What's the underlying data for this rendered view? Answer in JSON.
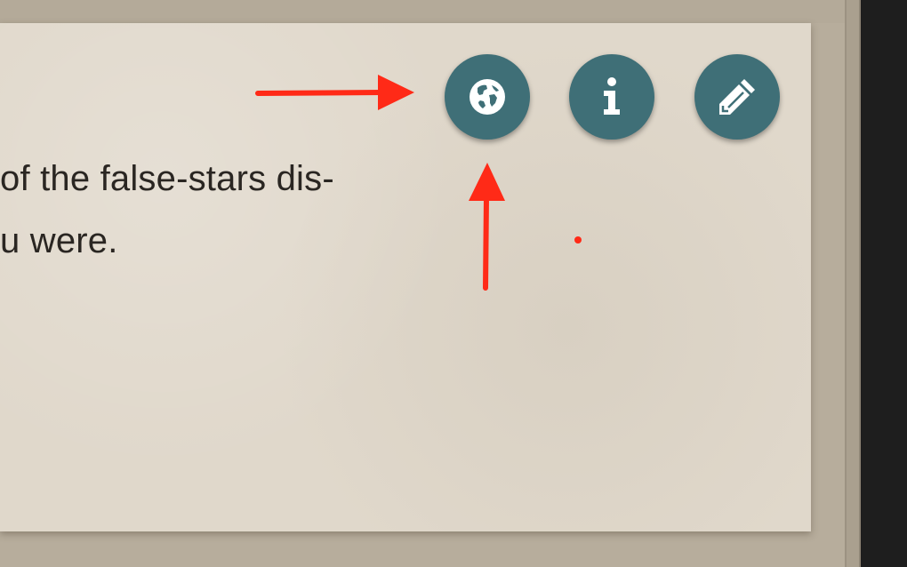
{
  "card": {
    "lines": [
      "of the false-stars dis-",
      "u were."
    ]
  },
  "buttons": [
    {
      "name": "globe-button",
      "icon": "globe-icon"
    },
    {
      "name": "info-button",
      "icon": "info-icon"
    },
    {
      "name": "edit-button",
      "icon": "pencil-icon"
    }
  ],
  "colors": {
    "button_bg": "#3f6f77",
    "card_bg": "#e0d8cb",
    "annotation": "#ff2a17",
    "text": "#2a2622"
  }
}
